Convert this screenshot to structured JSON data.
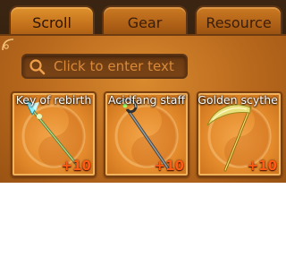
{
  "tabs": [
    {
      "label": "Scroll",
      "active": true
    },
    {
      "label": "Gear",
      "active": false
    },
    {
      "label": "Resource",
      "active": false
    }
  ],
  "search": {
    "placeholder": "Click to enter text",
    "icon": "search-icon"
  },
  "items": [
    {
      "name": "Key of rebirth",
      "enhance": "+10",
      "icon": "key-of-rebirth-icon"
    },
    {
      "name": "Acidfang staff",
      "enhance": "+10",
      "icon": "acidfang-staff-icon"
    },
    {
      "name": "Golden scythe",
      "enhance": "+10",
      "icon": "golden-scythe-icon"
    }
  ],
  "colors": {
    "accent": "#e38a2c",
    "enhance": "#ff5a14",
    "placeholder": "#d88a3a"
  }
}
